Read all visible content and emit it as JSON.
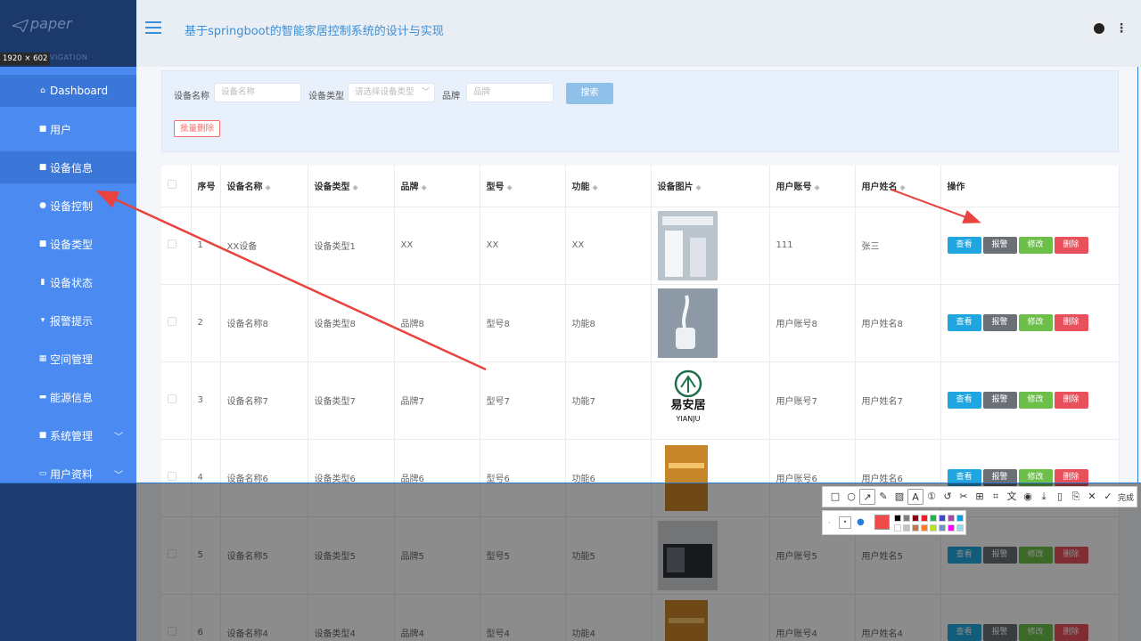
{
  "header": {
    "logo": "paper",
    "nav_label": "NAVIGATION",
    "dimension_badge": "1920 × 602",
    "title": "基于springboot的智能家居控制系统的设计与实现"
  },
  "sidebar": {
    "items": [
      {
        "label": "Dashboard",
        "icon": "home-icon"
      },
      {
        "label": "用户",
        "icon": "grid-icon"
      },
      {
        "label": "设备信息",
        "icon": "grid-icon"
      },
      {
        "label": "设备控制",
        "icon": "bulb-icon"
      },
      {
        "label": "设备类型",
        "icon": "grid-icon"
      },
      {
        "label": "设备状态",
        "icon": "chart-icon"
      },
      {
        "label": "报警提示",
        "icon": "trophy-icon"
      },
      {
        "label": "空间管理",
        "icon": "table-icon"
      },
      {
        "label": "能源信息",
        "icon": "comment-icon"
      },
      {
        "label": "系统管理",
        "icon": "grid-icon"
      },
      {
        "label": "用户资料",
        "icon": "calendar-icon"
      }
    ]
  },
  "search": {
    "name_label": "设备名称",
    "name_placeholder": "设备名称",
    "type_label": "设备类型",
    "type_placeholder": "请选择设备类型",
    "brand_label": "品牌",
    "brand_placeholder": "品牌",
    "search_button": "搜索",
    "batch_delete_button": "批量删除"
  },
  "table": {
    "headers": [
      "序号",
      "设备名称",
      "设备类型",
      "品牌",
      "型号",
      "功能",
      "设备图片",
      "用户账号",
      "用户姓名",
      "操作"
    ],
    "actions": [
      "查看",
      "报警",
      "修改",
      "删除"
    ],
    "rows": [
      {
        "no": "1",
        "name": "XX设备",
        "type": "设备类型1",
        "brand": "XX",
        "model": "XX",
        "func": "XX",
        "account": "111",
        "user": "张三"
      },
      {
        "no": "2",
        "name": "设备名称8",
        "type": "设备类型8",
        "brand": "品牌8",
        "model": "型号8",
        "func": "功能8",
        "account": "用户账号8",
        "user": "用户姓名8"
      },
      {
        "no": "3",
        "name": "设备名称7",
        "type": "设备类型7",
        "brand": "品牌7",
        "model": "型号7",
        "func": "功能7",
        "account": "用户账号7",
        "user": "用户姓名7"
      },
      {
        "no": "4",
        "name": "设备名称6",
        "type": "设备类型6",
        "brand": "品牌6",
        "model": "型号6",
        "func": "功能6",
        "account": "用户账号6",
        "user": "用户姓名6"
      },
      {
        "no": "5",
        "name": "设备名称5",
        "type": "设备类型5",
        "brand": "品牌5",
        "model": "型号5",
        "func": "功能5",
        "account": "用户账号5",
        "user": "用户姓名5"
      },
      {
        "no": "6",
        "name": "设备名称4",
        "type": "设备类型4",
        "brand": "品牌4",
        "model": "型号4",
        "func": "功能4",
        "account": "用户账号4",
        "user": "用户姓名4"
      }
    ],
    "logo_cn": "易安居",
    "logo_en": "YIANJU"
  },
  "screenshot_tool": {
    "done_label": "完成",
    "tools": [
      "rect-icon",
      "ellipse-icon",
      "arrow-icon",
      "pen-icon",
      "mosaic-icon",
      "text-icon",
      "number-icon",
      "undo-icon",
      "cut-icon",
      "pin-icon",
      "ocr-icon",
      "translate-icon",
      "record-icon",
      "save-icon",
      "long-shot-icon",
      "bookmark-icon",
      "close-icon",
      "check-icon"
    ],
    "selected_color": "#f04a4a",
    "palette": [
      "#000000",
      "#7f7f7f",
      "#880015",
      "#ed1c24",
      "#22b14c",
      "#3f48cc",
      "#a349a4",
      "#00a2e8",
      "#ffffff",
      "#c3c3c3",
      "#b97a57",
      "#ff7f27",
      "#b5e61d",
      "#7092be",
      "#ff00ff",
      "#99d9ea"
    ]
  },
  "colors": {
    "sidebar": "#4a8af1",
    "sidebar_active": "#3b76d9",
    "title": "#3a8fd6",
    "arrow": "#e8433f"
  }
}
